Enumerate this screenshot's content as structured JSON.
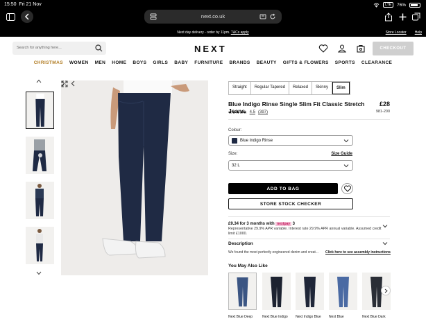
{
  "status": {
    "time": "15:50",
    "date": "Fri 21 Nov",
    "network": "LTE",
    "battery": "76%"
  },
  "browser": {
    "url": "next.co.uk"
  },
  "promo": {
    "text": "Next day delivery - order by 11pm.",
    "link": "T&Cs apply",
    "store_locator": "Store Locator",
    "help": "Help"
  },
  "header": {
    "search_placeholder": "Search for anything here...",
    "logo": "NEXT",
    "checkout": "CHECKOUT"
  },
  "nav": [
    "CHRISTMAS",
    "WOMEN",
    "MEN",
    "HOME",
    "BOYS",
    "GIRLS",
    "BABY",
    "FURNITURE",
    "BRANDS",
    "BEAUTY",
    "GIFTS & FLOWERS",
    "SPORTS",
    "CLEARANCE"
  ],
  "fit_tabs": [
    "Straight",
    "Regular Tapered",
    "Relaxed",
    "Skinny",
    "Slim"
  ],
  "active_fit": "Slim",
  "product": {
    "title": "Blue Indigo Rinse Single Slim Fit Classic Stretch Jeans",
    "price": "£28",
    "stars": "★★★★★",
    "rating": "4.5",
    "reviews": "(397)",
    "sku": "981-200",
    "colour_label": "Colour:",
    "colour_value": "Blue Indigo Rinse",
    "size_label": "Size:",
    "size_guide": "Size Guide",
    "size_value": "32 L",
    "add_to_bag": "ADD TO BAG",
    "store_checker": "STORE STOCK CHECKER"
  },
  "finance": {
    "headline": "£9.34 for 3 months with",
    "badge": "nextpay",
    "badge_num": "3",
    "detail": "Representative 29.9% APR variable. Interest rate 29.9% APR annual variable. Assumed credit limit £1000."
  },
  "description": {
    "title": "Description",
    "text": "We found the most perfectly engineered denim and creat...",
    "link": "Click here to see assembly instructions"
  },
  "recommendations": {
    "title": "You May Also Like",
    "items": [
      "Next Blue Deep",
      "Next Blue Indigo",
      "Next Indigo Blue",
      "Next Blue",
      "Next Blue Dark"
    ]
  },
  "colors": {
    "xmas": "#b07a1f",
    "denim": "#1f2a44"
  }
}
